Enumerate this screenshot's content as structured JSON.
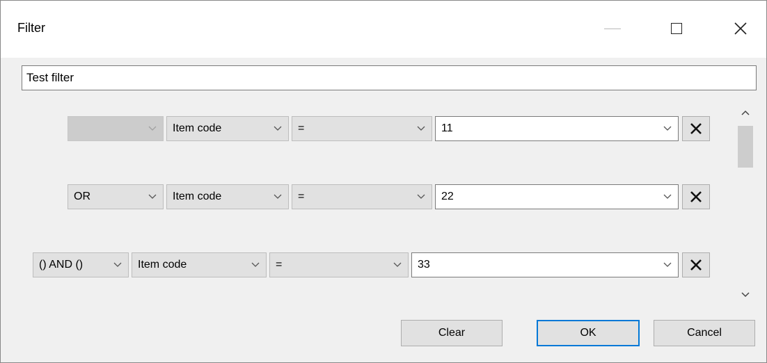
{
  "window": {
    "title": "Filter"
  },
  "filter_name": {
    "value": "Test filter"
  },
  "rows": [
    {
      "connector": "",
      "field": "Item code",
      "operator": "=",
      "value": "11"
    },
    {
      "connector": "OR",
      "field": "Item code",
      "operator": "=",
      "value": "22"
    },
    {
      "connector": "() AND ()",
      "field": "Item code",
      "operator": "=",
      "value": "33"
    }
  ],
  "buttons": {
    "clear": "Clear",
    "ok": "OK",
    "cancel": "Cancel"
  },
  "colors": {
    "accent": "#0078d7",
    "control_bg": "#e1e1e1",
    "window_bg": "#f0f0f0"
  }
}
